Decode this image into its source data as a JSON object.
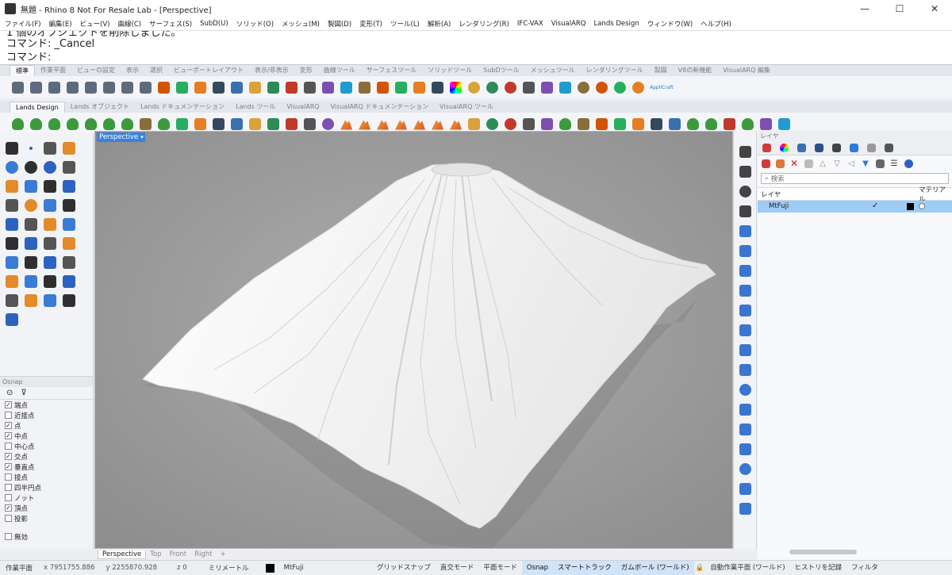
{
  "window": {
    "title": "無題 - Rhino 8 Not For Resale Lab - [Perspective]",
    "minimize": "—",
    "maximize": "☐",
    "close": "✕"
  },
  "menu": [
    "ファイル(F)",
    "編集(E)",
    "ビュー(V)",
    "曲線(C)",
    "サーフェス(S)",
    "SubD(U)",
    "ソリッド(O)",
    "メッシュ(M)",
    "製図(D)",
    "変形(T)",
    "ツール(L)",
    "解析(A)",
    "レンダリング(R)",
    "IFC-VAX",
    "VisualARQ",
    "Lands Design",
    "ウィンドウ(W)",
    "ヘルプ(H)"
  ],
  "command": {
    "history0": "1 個のオブジェクトを削除しました。",
    "history1": "コマンド: _Cancel",
    "prompt": "コマンド:"
  },
  "tabs1": [
    "標準",
    "作業平面",
    "ビューの設定",
    "表示",
    "選択",
    "ビューポートレイアウト",
    "表示/非表示",
    "変形",
    "曲線ツール",
    "サーフェスツール",
    "ソリッドツール",
    "SubDツール",
    "メッシュツール",
    "レンダリングツール",
    "製図",
    "V8の新機能",
    "VisualARQ 編集"
  ],
  "tabs2": [
    "Lands Design",
    "Lands オブジェクト",
    "Lands ドキュメンテーション",
    "Lands ツール",
    "VisualARQ",
    "VisualARQ ドキュメンテーション",
    "VisualARQ ツール"
  ],
  "toolbar1_icons": [
    "new-icon",
    "open-icon",
    "save-icon",
    "print-icon",
    "import-icon",
    "cut-icon",
    "copy-icon",
    "paste-icon",
    "undo-icon",
    "pan-hand-icon",
    "move-view-icon",
    "zoom-icon",
    "zoom-window-icon",
    "zoom-extents-icon",
    "zoom-selected-icon",
    "rotate-view-icon",
    "four-views-icon",
    "car-icon",
    "grid-icon",
    "cplane-icon",
    "points-icon",
    "hide-icon",
    "lock-icon",
    "layer-icon",
    "color-wheel-icon",
    "sphere-wire-icon",
    "sphere-shaded-icon",
    "sphere-render-icon",
    "osnap-icon",
    "gear-icon",
    "dims-icon",
    "globe-icon",
    "help-icon",
    "app-icon",
    "applicraft-icon"
  ],
  "toolbar1_tail": "AppliCraft",
  "toolbar2_icons": [
    "tree1-icon",
    "tree2-icon",
    "tree3-icon",
    "tree4-icon",
    "tree5-icon",
    "hedge-icon",
    "shrub-icon",
    "grass-icon",
    "plant-icon",
    "wall-icon",
    "fence-icon",
    "path-icon",
    "terrain-icon",
    "shed-icon",
    "pavers-icon",
    "bars-icon",
    "people-icon",
    "sphere-globe-icon",
    "mountain1-icon",
    "mountain2-icon",
    "mountain3-icon",
    "mountain4-icon",
    "mountain5-icon",
    "mountain6-icon",
    "mountain7-icon",
    "truck-icon",
    "water-drop-icon",
    "drops-icon",
    "pipe-icon",
    "slide-icon",
    "label-tree-icon",
    "sheet-icon",
    "plan-icon",
    "tag-icon",
    "tag2-icon",
    "tag3-icon",
    "tag4-icon",
    "tree-tag-icon",
    "tree-tag2-icon",
    "frame-icon",
    "tree-frame-icon",
    "axis-icon",
    "target-icon"
  ],
  "left_tools": [
    "select-icon",
    "point-icon",
    "polyline-icon",
    "curve-icon",
    "circle-icon",
    "ellipse-icon",
    "arc-icon",
    "rectangle-icon",
    "polygon-icon",
    "fillet-icon",
    "surface-icon",
    "surface2-icon",
    "box-icon",
    "sphere-icon",
    "cylinder-icon",
    "mesh-icon",
    "boolean-icon",
    "explode-icon",
    "trim-icon",
    "split-icon",
    "group-icon",
    "join-icon",
    "offset-icon",
    "extend-icon",
    "text-icon",
    "dim-icon",
    "array-icon",
    "scale-icon",
    "solid-icon",
    "array2-icon",
    "grid-tool-icon",
    "block-icon",
    "clip-icon",
    "align-icon",
    "check-icon",
    "analyze-icon",
    "pencil-icon"
  ],
  "osnap": {
    "header": "Osnap",
    "items": [
      {
        "label": "端点",
        "checked": true
      },
      {
        "label": "近接点",
        "checked": false
      },
      {
        "label": "点",
        "checked": true
      },
      {
        "label": "中点",
        "checked": true
      },
      {
        "label": "中心点",
        "checked": false
      },
      {
        "label": "交点",
        "checked": true
      },
      {
        "label": "垂直点",
        "checked": true
      },
      {
        "label": "接点",
        "checked": false
      },
      {
        "label": "四半円点",
        "checked": false
      },
      {
        "label": "ノット",
        "checked": false
      },
      {
        "label": "頂点",
        "checked": true
      },
      {
        "label": "投影",
        "checked": false
      }
    ],
    "disable": "無効"
  },
  "viewport": {
    "name": "Perspective",
    "tabs": [
      "Perspective",
      "Top",
      "Front",
      "Right"
    ],
    "add": "+"
  },
  "right_tools": [
    "polygon-mesh-icon",
    "edge-curve-icon",
    "sphere-split-icon",
    "arc-edit-icon",
    "plane-icon",
    "plane2-icon",
    "extrude-icon",
    "cylinder2-icon",
    "surface-edit-icon",
    "surface-edit2-icon",
    "patch-icon",
    "network-icon",
    "sphere-blue-icon",
    "box-blue-icon",
    "box-blue2-icon",
    "shape-icon",
    "sphere-cut-icon",
    "cube-blue-icon",
    "dimension-icon"
  ],
  "layers": {
    "header": "レイヤ",
    "search_placeholder": "検索",
    "col_name": "レイヤ",
    "col_material": "マテリアル",
    "rows": [
      {
        "name": "MtFuji",
        "current": "✓",
        "color": "#000000"
      }
    ]
  },
  "status": {
    "cplane": "作業平面",
    "x": "x 7951755.886",
    "y": "y 2255870.928",
    "z": "z 0",
    "units": "ミリメートル",
    "layer": "MtFuji",
    "grid_snap": "グリッドスナップ",
    "ortho": "直交モード",
    "planar": "平面モード",
    "osnap": "Osnap",
    "smarttrack": "スマートトラック",
    "gumball": "ガムボール (ワールド)",
    "auto_cplane": "自動作業平面 (ワールド)",
    "history": "ヒストリを記録",
    "filter": "フィルタ"
  },
  "colors": {
    "accent": "#3b82dd",
    "layer_selected": "#9dccf5",
    "viewport_bg": "#9a9a9a",
    "terrain": "#f4f4f4"
  }
}
